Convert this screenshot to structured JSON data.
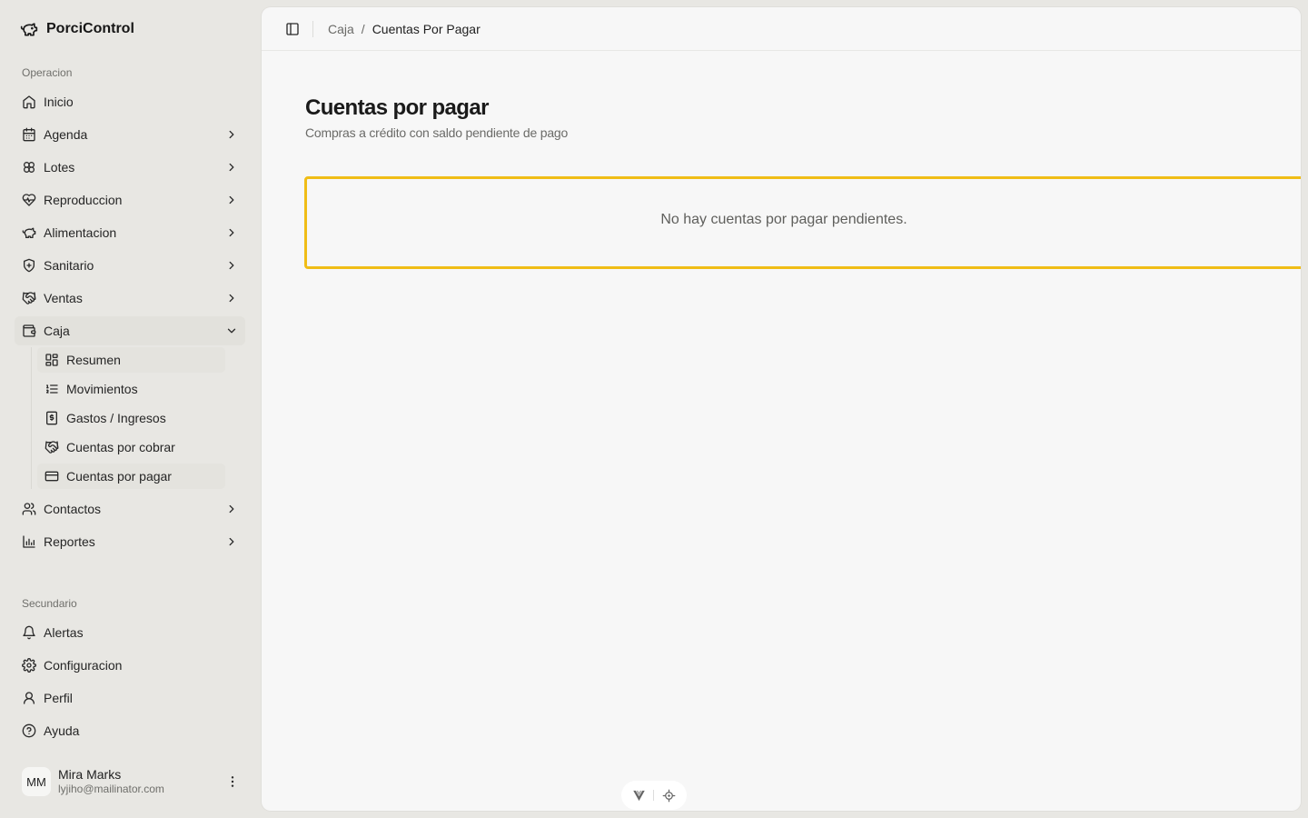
{
  "app": {
    "name": "PorciControl",
    "logo_icon": "pig-icon"
  },
  "sidebar": {
    "groups": {
      "operacion": "Operacion",
      "secundario": "Secundario"
    },
    "items": [
      {
        "label": "Inicio",
        "icon": "home-icon"
      },
      {
        "label": "Agenda",
        "icon": "calendar-icon"
      },
      {
        "label": "Lotes",
        "icon": "lotes-icon"
      },
      {
        "label": "Reproduccion",
        "icon": "heart-pulse-icon"
      },
      {
        "label": "Alimentacion",
        "icon": "pig-icon"
      },
      {
        "label": "Sanitario",
        "icon": "shield-plus-icon"
      },
      {
        "label": "Ventas",
        "icon": "handshake-icon"
      },
      {
        "label": "Caja",
        "icon": "wallet-icon"
      },
      {
        "label": "Contactos",
        "icon": "users-icon"
      },
      {
        "label": "Reportes",
        "icon": "bar-chart-icon"
      }
    ],
    "caja_sub": [
      {
        "label": "Resumen",
        "icon": "grid-icon"
      },
      {
        "label": "Movimientos",
        "icon": "list-ordered-icon"
      },
      {
        "label": "Gastos / Ingresos",
        "icon": "receipt-icon"
      },
      {
        "label": "Cuentas por cobrar",
        "icon": "handshake-icon"
      },
      {
        "label": "Cuentas por pagar",
        "icon": "credit-card-icon"
      }
    ],
    "secondary": [
      {
        "label": "Alertas",
        "icon": "bell-icon"
      },
      {
        "label": "Configuracion",
        "icon": "gear-icon"
      },
      {
        "label": "Perfil",
        "icon": "user-icon"
      },
      {
        "label": "Ayuda",
        "icon": "help-circle-icon"
      }
    ],
    "user": {
      "initials": "MM",
      "name": "Mira Marks",
      "email": "lyjiho@mailinator.com"
    }
  },
  "header": {
    "breadcrumb": {
      "parent": "Caja",
      "separator": "/",
      "current": "Cuentas Por Pagar"
    }
  },
  "page": {
    "title": "Cuentas por pagar",
    "subtitle": "Compras a crédito con saldo pendiente de pago",
    "empty_message": "No hay cuentas por pagar pendientes."
  },
  "colors": {
    "highlight_border": "#f0bd16",
    "sidebar_bg": "#e8e7e3",
    "main_bg": "#f7f7f7"
  }
}
